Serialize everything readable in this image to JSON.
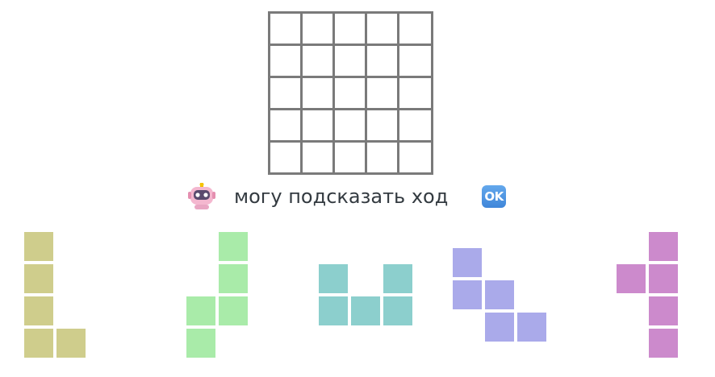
{
  "board": {
    "rows": 5,
    "cols": 5,
    "line_color": "#7a7a7a"
  },
  "hint": {
    "text": "могу подсказать ход",
    "ok_label": "OK",
    "bot_icon": "robot-icon"
  },
  "pieces": [
    {
      "name": "piece-yellow-l",
      "color": "#cfcd8c",
      "cells": [
        [
          0,
          0
        ],
        [
          1,
          0
        ],
        [
          2,
          0
        ],
        [
          3,
          0
        ],
        [
          3,
          1
        ]
      ]
    },
    {
      "name": "piece-green-j",
      "color": "#a9eba9",
      "cells": [
        [
          0,
          1
        ],
        [
          1,
          1
        ],
        [
          2,
          0
        ],
        [
          2,
          1
        ],
        [
          3,
          0
        ]
      ]
    },
    {
      "name": "piece-teal-u",
      "color": "#8ccfcd",
      "cells": [
        [
          0,
          0
        ],
        [
          0,
          2
        ],
        [
          1,
          0
        ],
        [
          1,
          1
        ],
        [
          1,
          2
        ]
      ]
    },
    {
      "name": "piece-blue-w",
      "color": "#aaaaea",
      "cells": [
        [
          0,
          0
        ],
        [
          1,
          0
        ],
        [
          1,
          1
        ],
        [
          2,
          1
        ],
        [
          2,
          2
        ]
      ]
    },
    {
      "name": "piece-magenta-y",
      "color": "#cc8acc",
      "cells": [
        [
          0,
          1
        ],
        [
          1,
          0
        ],
        [
          1,
          1
        ],
        [
          2,
          1
        ],
        [
          3,
          1
        ]
      ]
    }
  ]
}
